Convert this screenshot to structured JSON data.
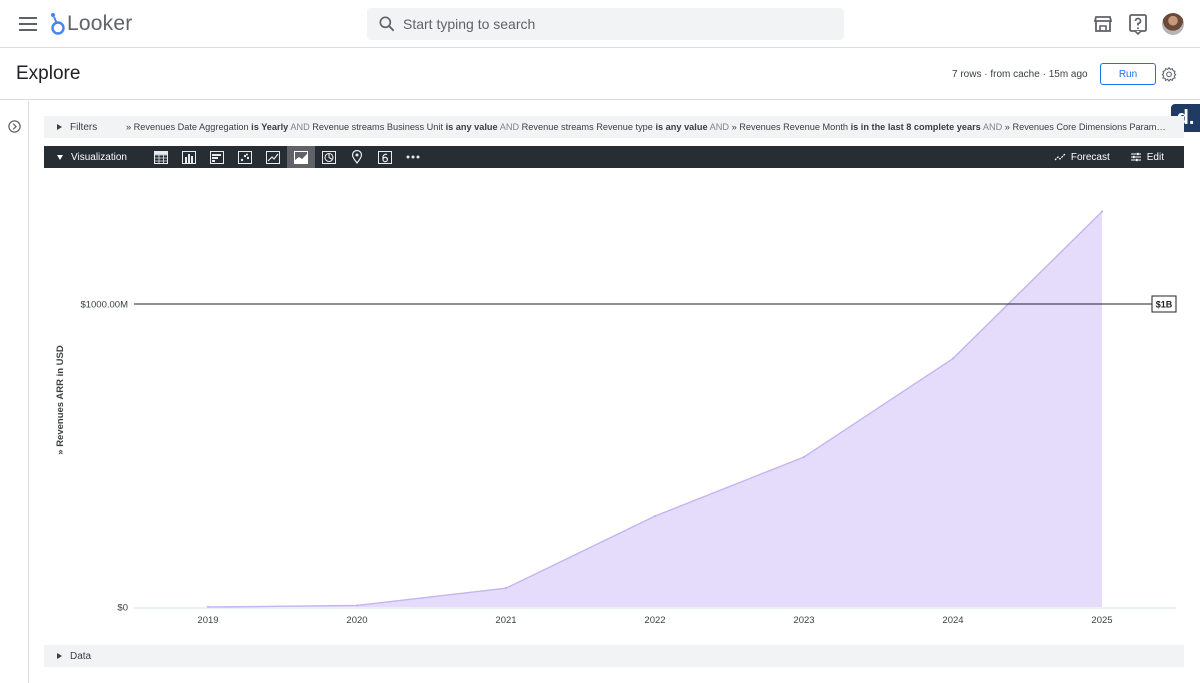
{
  "app": {
    "name": "Looker"
  },
  "search": {
    "placeholder": "Start typing to search"
  },
  "header": {
    "title": "Explore",
    "status": "7 rows · from cache · 15m ago",
    "run_label": "Run"
  },
  "filters": {
    "label": "Filters",
    "summary": [
      {
        "t": "» Revenues Date Aggregation ",
        "s": "plain"
      },
      {
        "t": "is Yearly",
        "s": "bold"
      },
      {
        "t": " AND ",
        "s": "and"
      },
      {
        "t": "Revenue streams Business Unit ",
        "s": "plain"
      },
      {
        "t": "is any value",
        "s": "bold"
      },
      {
        "t": " AND ",
        "s": "and"
      },
      {
        "t": "Revenue streams Revenue type ",
        "s": "plain"
      },
      {
        "t": "is any value",
        "s": "bold"
      },
      {
        "t": " AND ",
        "s": "and"
      },
      {
        "t": "» Revenues Revenue Month ",
        "s": "plain"
      },
      {
        "t": "is in the last 8 complete years",
        "s": "bold"
      },
      {
        "t": " AND ",
        "s": "and"
      },
      {
        "t": "» Revenues Core Dimensions Paramet...",
        "s": "plain"
      }
    ]
  },
  "badge": {
    "letter": "d."
  },
  "visualization": {
    "label": "Visualization",
    "forecast_label": "Forecast",
    "edit_label": "Edit"
  },
  "data_section": {
    "label": "Data"
  },
  "colors": {
    "area_fill": "#e5dcfb",
    "area_line": "#c5b4f0",
    "reference_line": "#202124"
  },
  "chart_data": {
    "type": "area",
    "x": [
      "2019",
      "2020",
      "2021",
      "2022",
      "2023",
      "2024",
      "2025"
    ],
    "series": [
      {
        "values": [
          0,
          5,
          62,
          300,
          495,
          820,
          1305
        ]
      }
    ],
    "ylabel": "» Revenues ARR in USD",
    "yticks": [
      {
        "value": 0,
        "label": "$0"
      },
      {
        "value": 1000,
        "label": "$1000.00M"
      }
    ],
    "ylim": [
      0,
      1000
    ],
    "y_unit": "millions USD",
    "reference_line": {
      "value": 1000,
      "label": "$1B"
    },
    "grid": false
  }
}
